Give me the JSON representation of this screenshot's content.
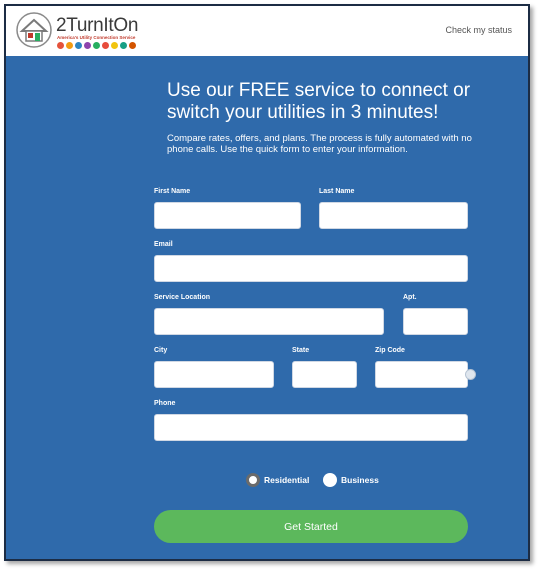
{
  "header": {
    "logo_name": "2TurnItOn",
    "logo_tagline": "America's Utility Connection Service",
    "check_status_link": "Check my status"
  },
  "colors": {
    "background": "#2f6aab",
    "cta": "#5cb85c",
    "logo_dots": [
      "#e5533b",
      "#f39c12",
      "#2e86c1",
      "#8e44ad",
      "#27ae60",
      "#e74c3c",
      "#f1c40f",
      "#16a085",
      "#d35400"
    ]
  },
  "hero": {
    "title": "Use our FREE service to connect or switch your utilities in 3 minutes!",
    "subtitle": "Compare rates, offers, and plans. The process is fully automated with no phone calls. Use the quick form to enter your information."
  },
  "form": {
    "first_name": {
      "label": "First Name",
      "value": ""
    },
    "last_name": {
      "label": "Last Name",
      "value": ""
    },
    "email": {
      "label": "Email",
      "value": ""
    },
    "service_location": {
      "label": "Service Location",
      "value": ""
    },
    "apt": {
      "label": "Apt.",
      "value": ""
    },
    "city": {
      "label": "City",
      "value": ""
    },
    "state": {
      "label": "State",
      "value": ""
    },
    "zip": {
      "label": "Zip Code",
      "value": ""
    },
    "phone": {
      "label": "Phone",
      "value": ""
    },
    "account_type": {
      "selected": "Residential",
      "options": [
        "Residential",
        "Business"
      ]
    },
    "submit_label": "Get Started"
  }
}
